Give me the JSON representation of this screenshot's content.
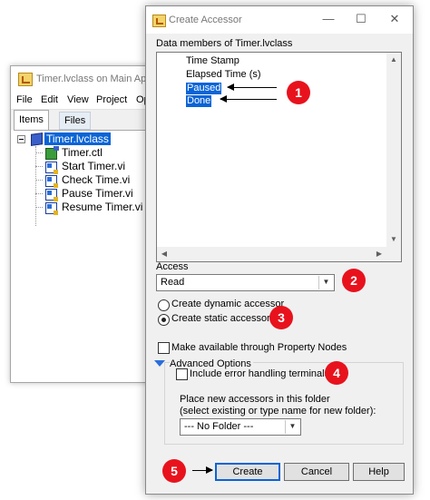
{
  "project_window": {
    "title": "Timer.lvclass on Main Appli",
    "menu": [
      "File",
      "Edit",
      "View",
      "Project",
      "Op"
    ],
    "tabs": [
      {
        "label": "Items",
        "active": true
      },
      {
        "label": "Files",
        "active": false
      }
    ],
    "tree": [
      {
        "label": "Timer.lvclass",
        "icon": "class-icon",
        "selected": true
      },
      {
        "label": "Timer.ctl",
        "icon": "control-icon"
      },
      {
        "label": "Start Timer.vi",
        "icon": "vi-icon"
      },
      {
        "label": "Check Time.vi",
        "icon": "vi-icon"
      },
      {
        "label": "Pause Timer.vi",
        "icon": "vi-icon"
      },
      {
        "label": "Resume Timer.vi",
        "icon": "vi-icon"
      }
    ]
  },
  "dialog": {
    "title": "Create Accessor",
    "window_controls": {
      "minimize": "—",
      "maximize": "☐",
      "close": "✕"
    },
    "members_label": "Data members of Timer.lvclass",
    "members": [
      {
        "label": "Time Stamp",
        "selected": false
      },
      {
        "label": "Elapsed Time (s)",
        "selected": false
      },
      {
        "label": "Paused",
        "selected": true
      },
      {
        "label": "Done",
        "selected": true
      }
    ],
    "access_label": "Access",
    "access_value": "Read",
    "radio_dynamic": "Create dynamic accessor",
    "radio_static": "Create static accessor",
    "static_selected": true,
    "property_nodes_label": "Make available through Property Nodes",
    "advanced_label": "Advanced Options",
    "error_terminals_label": "Include error handling terminals",
    "folder_label_1": "Place new accessors in this folder",
    "folder_label_2": "(select existing or type name for new folder):",
    "folder_value": "--- No Folder ---",
    "buttons": {
      "create": "Create",
      "cancel": "Cancel",
      "help": "Help"
    }
  },
  "callouts": [
    "1",
    "2",
    "3",
    "4",
    "5"
  ],
  "colors": {
    "selection": "#0a64d6",
    "callout": "#e8121d"
  }
}
